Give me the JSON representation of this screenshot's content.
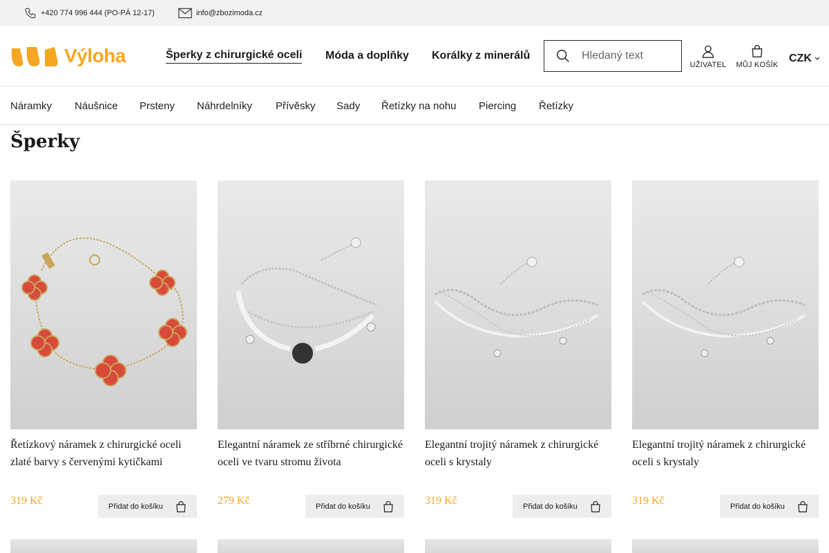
{
  "topbar": {
    "phone": "+420 774 996 444 (PO-PÁ 12-17)",
    "email": "info@zbozimoda.cz"
  },
  "header": {
    "logo_text": "Výloha",
    "brand_color": "#f5a623",
    "nav": [
      {
        "label": "Šperky z chirurgické oceli",
        "active": true
      },
      {
        "label": "Móda a doplňky",
        "active": false
      },
      {
        "label": "Korálky z minerálů",
        "active": false
      }
    ],
    "search": {
      "placeholder": "Hledaný text",
      "value": ""
    },
    "user_label": "UŽIVATEL",
    "cart_label": "MŮJ KOŠÍK",
    "currency": "CZK"
  },
  "categories": [
    "Náramky",
    "Náušnice",
    "Prsteny",
    "Náhrdelníky",
    "Přívěsky",
    "Sady",
    "Řetízky na nohu",
    "Piercing",
    "Řetízky"
  ],
  "page_title": "Šperky",
  "products": [
    {
      "name": "Řetízkový náramek z chirurgické oceli zlaté barvy s červenými kytičkami",
      "price": "319 Kč",
      "button": "Přidat do košíku",
      "image": "gold-red-clover-bracelet"
    },
    {
      "name": "Elegantní náramek ze stříbrné chirurgické oceli ve tvaru stromu života",
      "price": "279 Kč",
      "button": "Přidat do košíku",
      "image": "silver-tree-of-life-bracelet"
    },
    {
      "name": "Elegantní trojitý náramek z chirurgické oceli s krystaly",
      "price": "319 Kč",
      "button": "Přidat do košíku",
      "image": "silver-triple-crystal-bracelet"
    },
    {
      "name": "Elegantní trojitý náramek z chirurgické oceli s krystaly",
      "price": "319 Kč",
      "button": "Přidat do košíku",
      "image": "silver-triple-crystal-bracelet"
    }
  ]
}
